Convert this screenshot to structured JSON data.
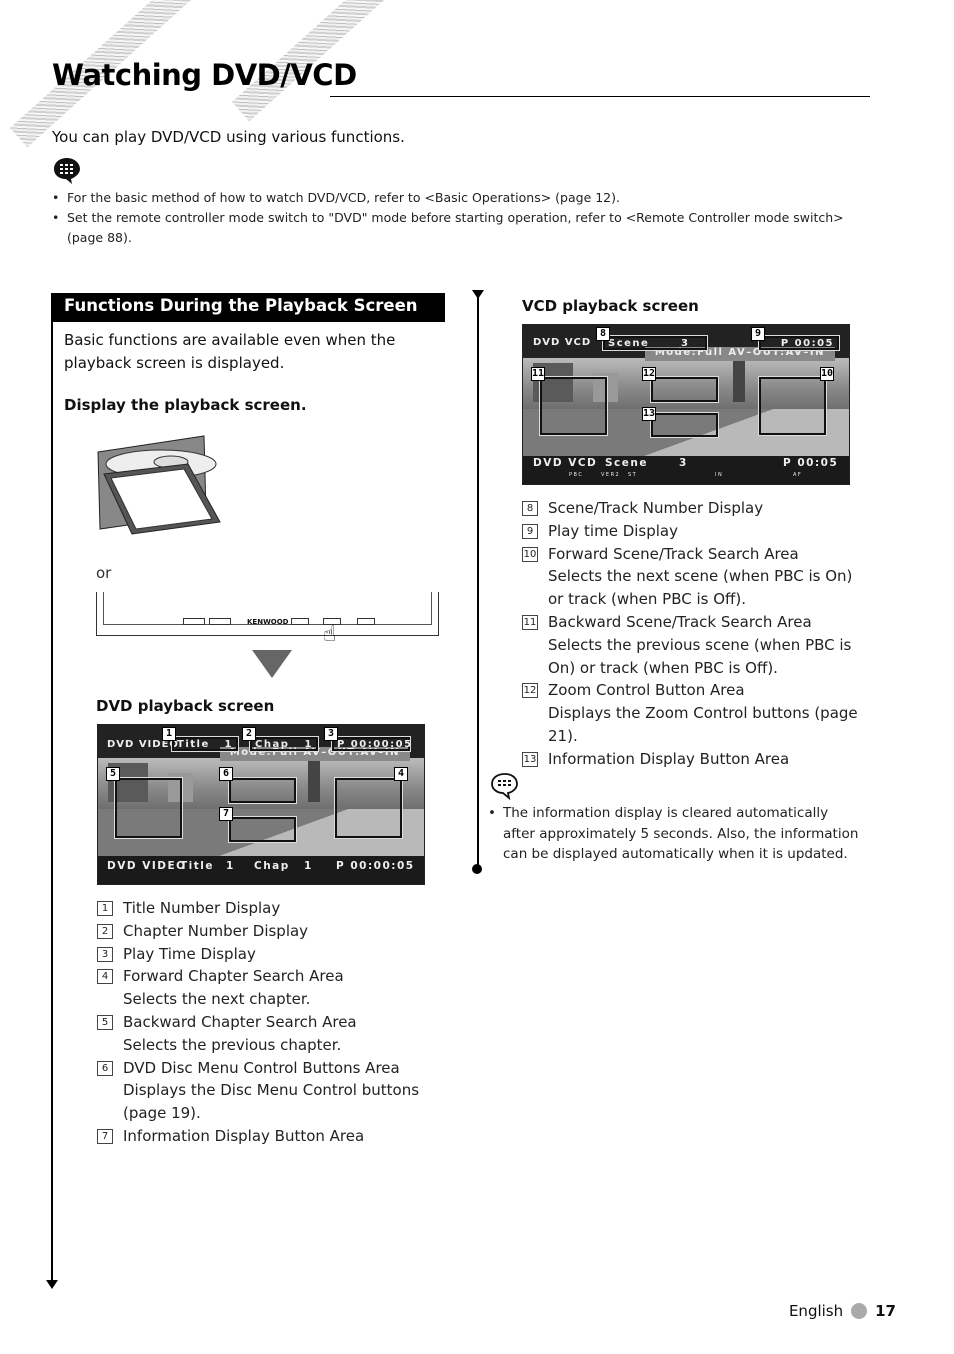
{
  "page": {
    "title": "Watching DVD/VCD",
    "intro": "You can play DVD/VCD using various functions.",
    "notes_top": [
      "For the basic method of how to watch DVD/VCD, refer to <Basic Operations> (page 12).",
      "Set the remote controller mode switch to \"DVD\" mode before starting operation, refer to <Remote Controller mode switch> (page 88)."
    ]
  },
  "section": {
    "heading": "Functions During the Playback Screen",
    "description": "Basic functions are available even when the playback screen is displayed.",
    "step": "Display the playback screen.",
    "or_label": "or",
    "panel_brand": "KENWOOD"
  },
  "dvd_screen": {
    "label": "DVD playback screen",
    "top": {
      "source": "DVD VIDEO",
      "title": "Title",
      "title_no": "1",
      "chap": "Chap",
      "chap_no": "1",
      "time": "P 00:00:05",
      "mode": "Mode:Full   AV–OUT:AV–IN"
    },
    "bottom": {
      "source": "DVD VIDEO",
      "title": "Title",
      "title_no": "1",
      "chap": "Chap",
      "chap_no": "1",
      "time": "P 00:00:05"
    },
    "callouts": [
      "1",
      "2",
      "3",
      "4",
      "5",
      "6",
      "7"
    ],
    "legend": [
      {
        "n": "1",
        "label": "Title Number Display"
      },
      {
        "n": "2",
        "label": "Chapter Number Display"
      },
      {
        "n": "3",
        "label": "Play Time Display"
      },
      {
        "n": "4",
        "label": "Forward Chapter Search Area",
        "desc": "Selects the next chapter."
      },
      {
        "n": "5",
        "label": "Backward Chapter Search Area",
        "desc": "Selects the previous chapter."
      },
      {
        "n": "6",
        "label": "DVD Disc Menu Control Buttons Area",
        "desc": "Displays the Disc Menu Control buttons (page 19)."
      },
      {
        "n": "7",
        "label": "Information Display Button Area"
      }
    ]
  },
  "vcd_screen": {
    "label": "VCD playback screen",
    "top": {
      "source": "DVD  VCD",
      "scene": "Scene",
      "scene_no": "3",
      "time": "P 00:05",
      "mode": "Mode:Full    AV–OUT:AV–IN"
    },
    "bottom": {
      "source": "DVD  VCD",
      "scene": "Scene",
      "scene_no": "3",
      "time": "P 00:05",
      "ind_pbc": "PBC",
      "ind_ver": "VER2",
      "ind_st": "ST",
      "ind_in": "IN",
      "ind_af": "AF"
    },
    "callouts": [
      "8",
      "9",
      "10",
      "11",
      "12",
      "13"
    ],
    "legend": [
      {
        "n": "8",
        "label": "Scene/Track Number Display"
      },
      {
        "n": "9",
        "label": "Play time Display"
      },
      {
        "n": "10",
        "label": "Forward Scene/Track Search Area",
        "desc": "Selects the next scene (when PBC is On) or track (when PBC is Off)."
      },
      {
        "n": "11",
        "label": "Backward Scene/Track Search Area",
        "desc": "Selects the previous scene (when PBC is On) or track (when PBC is Off)."
      },
      {
        "n": "12",
        "label": "Zoom Control Button Area",
        "desc": "Displays the Zoom Control buttons (page 21)."
      },
      {
        "n": "13",
        "label": "Information Display Button Area"
      }
    ],
    "note": "The information display is cleared automatically after approximately 5 seconds. Also, the information can be displayed automatically when it is updated."
  },
  "footer": {
    "language": "English",
    "page_number": "17"
  }
}
